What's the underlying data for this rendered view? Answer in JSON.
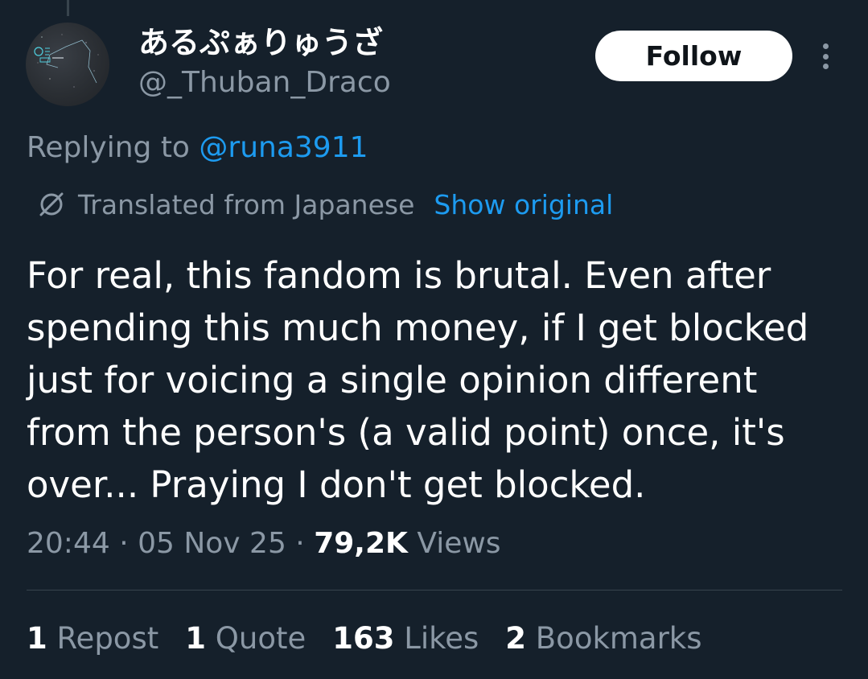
{
  "author": {
    "display_name": "あるぷぁりゅうざ",
    "handle": "@_Thuban_Draco"
  },
  "header": {
    "follow_label": "Follow"
  },
  "reply": {
    "prefix": "Replying to ",
    "mention": "@runa3911"
  },
  "translation": {
    "label": "Translated from Japanese",
    "show_original": "Show original"
  },
  "tweet": {
    "text": "For real, this fandom is brutal. Even after spending this much money, if I get blocked just for voicing a single opinion different from the person's (a valid point) once, it's over... Praying I don't get blocked."
  },
  "meta": {
    "time": "20:44",
    "date": "05 Nov 25",
    "views_count": "79,2K",
    "views_label": "Views"
  },
  "stats": {
    "reposts": {
      "count": "1",
      "label": "Repost"
    },
    "quotes": {
      "count": "1",
      "label": "Quote"
    },
    "likes": {
      "count": "163",
      "label": "Likes"
    },
    "bookmarks": {
      "count": "2",
      "label": "Bookmarks"
    }
  },
  "icons": {
    "avatar": "avatar-image",
    "translate": "translate-icon",
    "more": "more-options-icon"
  },
  "colors": {
    "background": "#15202b",
    "accent": "#1d9bf0",
    "secondary_text": "#8b98a5",
    "primary_text": "#ffffff"
  }
}
